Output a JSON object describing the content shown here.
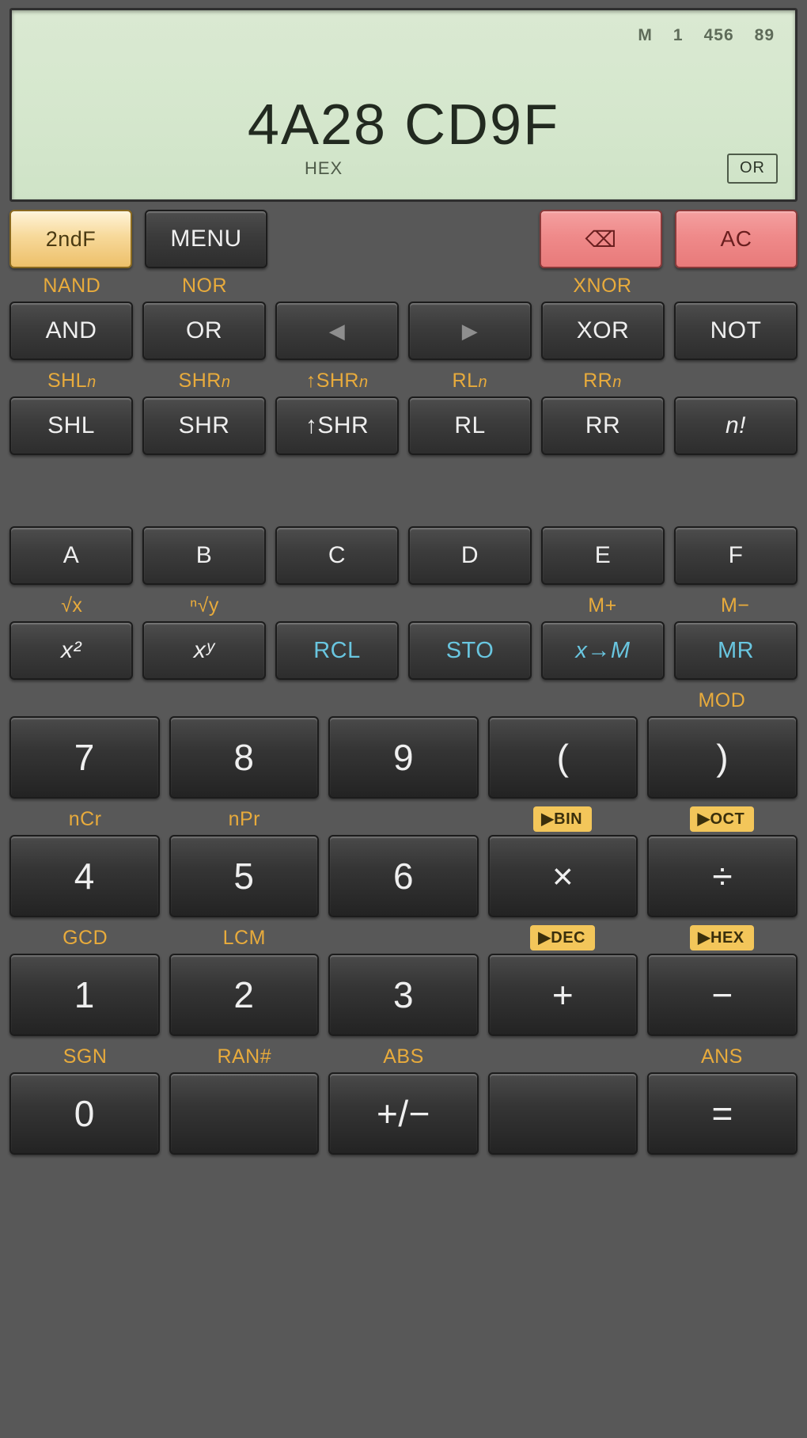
{
  "display": {
    "indicators": [
      "M",
      "1",
      "456",
      "89"
    ],
    "value": "4A28 CD9F",
    "base_label": "HEX",
    "pending_op": "OR"
  },
  "colors": {
    "shift_label": "#e8ab3c",
    "memory_key": "#69c6e0",
    "badge_bg": "#f3c65a",
    "second_fn": "#f7d99a",
    "clear_key": "#ef8a8a",
    "lcd_bg": "#d5e7cd",
    "body_bg": "#585858"
  },
  "toprow": {
    "second_fn": "2ndF",
    "menu": "MENU",
    "backspace": "⌫",
    "all_clear": "AC"
  },
  "rows": [
    {
      "shift": [
        "NAND",
        "NOR",
        "",
        "",
        "XNOR",
        ""
      ],
      "keys": [
        "AND",
        "OR",
        "◀",
        "▶",
        "XOR",
        "NOT"
      ]
    },
    {
      "shift": [
        "SHLn",
        "SHRn",
        "↑SHRn",
        "RLn",
        "RRn",
        ""
      ],
      "keys": [
        "SHL",
        "SHR",
        "↑SHR",
        "RL",
        "RR",
        "n!"
      ]
    },
    {
      "shift": [
        "",
        "",
        "",
        "",
        "",
        ""
      ],
      "keys": [
        "A",
        "B",
        "C",
        "D",
        "E",
        "F"
      ]
    },
    {
      "shift": [
        "√x",
        "ⁿ√y",
        "",
        "",
        "M+",
        "M−"
      ],
      "keys": [
        "x²",
        "xʸ",
        "RCL",
        "STO",
        "x→M",
        "MR"
      ]
    }
  ],
  "numpad": [
    {
      "shift": [
        "",
        "",
        "",
        "",
        "MOD"
      ],
      "shift_kind": [
        "text",
        "text",
        "text",
        "text",
        "text"
      ],
      "keys": [
        "7",
        "8",
        "9",
        "(",
        ")"
      ]
    },
    {
      "shift": [
        "nCr",
        "nPr",
        "",
        "▶BIN",
        "▶OCT"
      ],
      "shift_kind": [
        "text",
        "text",
        "text",
        "badge",
        "badge"
      ],
      "keys": [
        "4",
        "5",
        "6",
        "×",
        "÷"
      ]
    },
    {
      "shift": [
        "GCD",
        "LCM",
        "",
        "▶DEC",
        "▶HEX"
      ],
      "shift_kind": [
        "text",
        "text",
        "text",
        "badge",
        "badge"
      ],
      "keys": [
        "1",
        "2",
        "3",
        "+",
        "−"
      ]
    },
    {
      "shift": [
        "SGN",
        "RAN#",
        "ABS",
        "",
        "ANS"
      ],
      "shift_kind": [
        "text",
        "text",
        "text",
        "text",
        "text"
      ],
      "keys": [
        "0",
        "",
        "+/−",
        "",
        "="
      ]
    }
  ]
}
